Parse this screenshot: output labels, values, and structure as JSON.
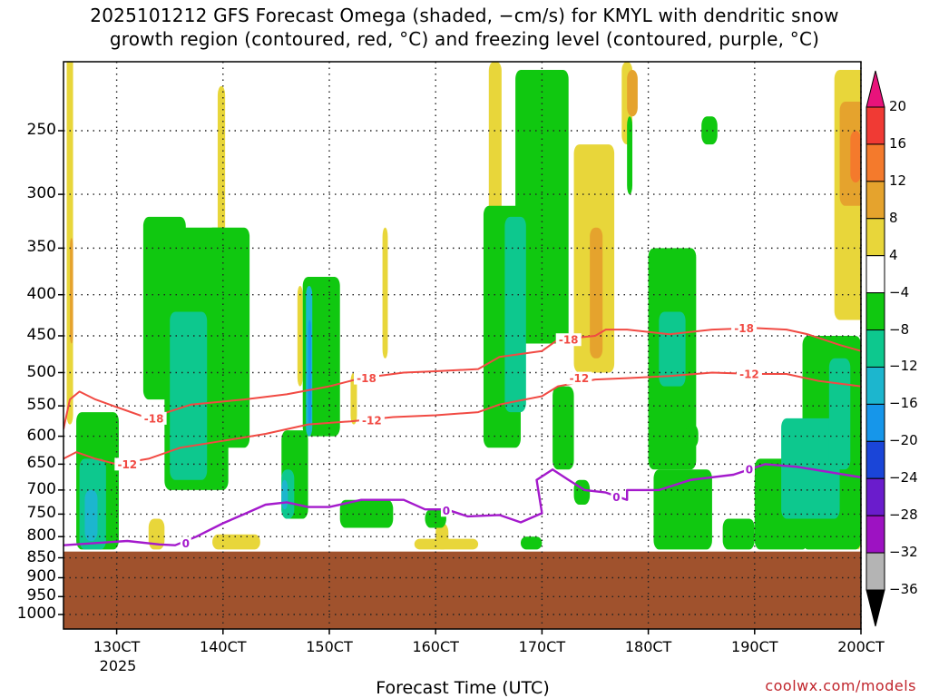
{
  "title": {
    "line1": "2025101212 GFS Forecast Omega (shaded, −cm/s) for KMYL with dendritic snow",
    "line2": "growth region (contoured, red, °C) and freezing level (contoured, purple, °C)"
  },
  "credit": "coolwx.com/models",
  "chart_data": {
    "type": "heatmap",
    "xlabel": "Forecast Time (UTC)",
    "year_label": "2025",
    "x_ticks": [
      "130CT",
      "140CT",
      "150CT",
      "160CT",
      "170CT",
      "180CT",
      "190CT",
      "200CT"
    ],
    "x_range_days": [
      12.5,
      20.0
    ],
    "y_ticks": [
      250,
      300,
      350,
      400,
      450,
      500,
      550,
      600,
      650,
      700,
      750,
      800,
      850,
      900,
      950,
      1000
    ],
    "y_range_hpa": [
      200,
      1050
    ],
    "grid": true,
    "terrain_below_hpa": 835,
    "terrain_color": "#a0522d",
    "colorbar": {
      "labels": [
        "20",
        "16",
        "12",
        "8",
        "4",
        "−4",
        "−8",
        "−12",
        "−16",
        "−20",
        "−24",
        "−28",
        "−32",
        "−36"
      ],
      "bins": [
        {
          "range": [
            20,
            999
          ],
          "color": "#e8137b"
        },
        {
          "range": [
            16,
            20
          ],
          "color": "#f03a34"
        },
        {
          "range": [
            12,
            16
          ],
          "color": "#f47a2c"
        },
        {
          "range": [
            8,
            12
          ],
          "color": "#e5a32d"
        },
        {
          "range": [
            4,
            8
          ],
          "color": "#e8d63a"
        },
        {
          "range": [
            -4,
            4
          ],
          "color": "#ffffff"
        },
        {
          "range": [
            -8,
            -4
          ],
          "color": "#10c810"
        },
        {
          "range": [
            -12,
            -8
          ],
          "color": "#0dc88e"
        },
        {
          "range": [
            -16,
            -12
          ],
          "color": "#1cb6ce"
        },
        {
          "range": [
            -20,
            -16
          ],
          "color": "#1696ea"
        },
        {
          "range": [
            -24,
            -20
          ],
          "color": "#1a45d8"
        },
        {
          "range": [
            -28,
            -24
          ],
          "color": "#6a1ccc"
        },
        {
          "range": [
            -32,
            -28
          ],
          "color": "#9d12c2"
        },
        {
          "range": [
            -36,
            -32
          ],
          "color": "#b4b4b4"
        },
        {
          "range": [
            -999,
            -36
          ],
          "color": "#000000"
        }
      ]
    },
    "omega_regions": [
      {
        "name": "yellow",
        "color": "#e8d63a",
        "value": 5,
        "x": 12.53,
        "w": 0.06,
        "p0": 200,
        "p1": 580
      },
      {
        "name": "yellow",
        "color": "#e8d63a",
        "value": 5,
        "x": 13.95,
        "w": 0.07,
        "p0": 220,
        "p1": 350
      },
      {
        "name": "yellow",
        "color": "#e8d63a",
        "value": 5,
        "x": 14.7,
        "w": 0.05,
        "p0": 390,
        "p1": 520
      },
      {
        "name": "yellow",
        "color": "#e8d63a",
        "value": 5,
        "x": 13.3,
        "w": 0.15,
        "p0": 760,
        "p1": 830
      },
      {
        "name": "yellow",
        "color": "#e8d63a",
        "value": 5,
        "x": 13.9,
        "w": 0.45,
        "p0": 795,
        "p1": 830
      },
      {
        "name": "yellow",
        "color": "#e8d63a",
        "value": 5,
        "x": 15.8,
        "w": 0.6,
        "p0": 805,
        "p1": 830
      },
      {
        "name": "yellow",
        "color": "#e8d63a",
        "value": 5,
        "x": 16.0,
        "w": 0.12,
        "p0": 770,
        "p1": 830
      },
      {
        "name": "yellow",
        "color": "#e8d63a",
        "value": 5,
        "x": 15.5,
        "w": 0.05,
        "p0": 330,
        "p1": 480
      },
      {
        "name": "yellow",
        "color": "#e8d63a",
        "value": 5,
        "x": 15.2,
        "w": 0.06,
        "p0": 500,
        "p1": 580
      },
      {
        "name": "yellow",
        "color": "#e8d63a",
        "value": 5,
        "x": 16.5,
        "w": 0.12,
        "p0": 205,
        "p1": 460
      },
      {
        "name": "yellow",
        "color": "#e8d63a",
        "value": 5,
        "x": 17.3,
        "w": 0.38,
        "p0": 260,
        "p1": 500
      },
      {
        "name": "yellow",
        "color": "#e8d63a",
        "value": 5,
        "x": 17.75,
        "w": 0.1,
        "p0": 205,
        "p1": 260
      },
      {
        "name": "yellow",
        "color": "#e8d63a",
        "value": 5,
        "x": 17.55,
        "w": 0.1,
        "p0": 435,
        "p1": 480
      },
      {
        "name": "yellow",
        "color": "#e8d63a",
        "value": 5,
        "x": 18.3,
        "w": 0.07,
        "p0": 510,
        "p1": 550
      },
      {
        "name": "yellow",
        "color": "#e8d63a",
        "value": 5,
        "x": 19.75,
        "w": 0.45,
        "p0": 210,
        "p1": 430
      },
      {
        "name": "yellow",
        "color": "#e8d63a",
        "value": 5,
        "x": 19.62,
        "w": 0.12,
        "p0": 500,
        "p1": 540
      },
      {
        "name": "yellow",
        "color": "#e8d63a",
        "value": 5,
        "x": 19.95,
        "w": 0.05,
        "p0": 760,
        "p1": 830
      },
      {
        "name": "gold",
        "color": "#e5a32d",
        "value": 10,
        "x": 17.45,
        "w": 0.12,
        "p0": 330,
        "p1": 480
      },
      {
        "name": "gold",
        "color": "#e5a32d",
        "value": 10,
        "x": 17.8,
        "w": 0.1,
        "p0": 210,
        "p1": 240
      },
      {
        "name": "gold",
        "color": "#e5a32d",
        "value": 10,
        "x": 19.8,
        "w": 0.3,
        "p0": 230,
        "p1": 310
      },
      {
        "name": "gold",
        "color": "#e5a32d",
        "value": 10,
        "x": 12.56,
        "w": 0.03,
        "p0": 340,
        "p1": 460
      },
      {
        "name": "orange",
        "color": "#f47a2c",
        "value": 14,
        "x": 19.9,
        "w": 0.1,
        "p0": 250,
        "p1": 290
      },
      {
        "name": "green",
        "color": "#10c810",
        "value": -6,
        "x": 12.62,
        "w": 0.4,
        "p0": 560,
        "p1": 830
      },
      {
        "name": "green",
        "color": "#10c810",
        "value": -6,
        "x": 13.25,
        "w": 0.4,
        "p0": 320,
        "p1": 540
      },
      {
        "name": "green",
        "color": "#10c810",
        "value": -6,
        "x": 13.45,
        "w": 0.6,
        "p0": 330,
        "p1": 700
      },
      {
        "name": "green",
        "color": "#10c810",
        "value": -6,
        "x": 13.85,
        "w": 0.4,
        "p0": 330,
        "p1": 620
      },
      {
        "name": "green",
        "color": "#10c810",
        "value": -6,
        "x": 14.55,
        "w": 0.25,
        "p0": 590,
        "p1": 760
      },
      {
        "name": "green",
        "color": "#10c810",
        "value": -6,
        "x": 14.75,
        "w": 0.35,
        "p0": 380,
        "p1": 600
      },
      {
        "name": "green",
        "color": "#10c810",
        "value": -6,
        "x": 15.1,
        "w": 0.5,
        "p0": 720,
        "p1": 780
      },
      {
        "name": "green",
        "color": "#10c810",
        "value": -6,
        "x": 15.9,
        "w": 0.2,
        "p0": 740,
        "p1": 780
      },
      {
        "name": "green",
        "color": "#10c810",
        "value": -6,
        "x": 16.45,
        "w": 0.35,
        "p0": 310,
        "p1": 620
      },
      {
        "name": "green",
        "color": "#10c810",
        "value": -6,
        "x": 16.75,
        "w": 0.5,
        "p0": 210,
        "p1": 460
      },
      {
        "name": "green",
        "color": "#10c810",
        "value": -6,
        "x": 16.8,
        "w": 0.2,
        "p0": 800,
        "p1": 830
      },
      {
        "name": "green",
        "color": "#10c810",
        "value": -6,
        "x": 17.1,
        "w": 0.2,
        "p0": 520,
        "p1": 660
      },
      {
        "name": "green",
        "color": "#10c810",
        "value": -6,
        "x": 17.3,
        "w": 0.15,
        "p0": 680,
        "p1": 730
      },
      {
        "name": "green",
        "color": "#10c810",
        "value": -6,
        "x": 17.8,
        "w": 0.05,
        "p0": 240,
        "p1": 300
      },
      {
        "name": "green",
        "color": "#10c810",
        "value": -6,
        "x": 18.0,
        "w": 0.45,
        "p0": 350,
        "p1": 660
      },
      {
        "name": "green",
        "color": "#10c810",
        "value": -6,
        "x": 18.05,
        "w": 0.55,
        "p0": 660,
        "p1": 830
      },
      {
        "name": "green",
        "color": "#10c810",
        "value": -6,
        "x": 18.5,
        "w": 0.15,
        "p0": 240,
        "p1": 260
      },
      {
        "name": "green",
        "color": "#10c810",
        "value": -6,
        "x": 18.7,
        "w": 0.3,
        "p0": 760,
        "p1": 830
      },
      {
        "name": "green",
        "color": "#10c810",
        "value": -6,
        "x": 19.0,
        "w": 0.5,
        "p0": 640,
        "p1": 830
      },
      {
        "name": "green",
        "color": "#10c810",
        "value": -6,
        "x": 19.45,
        "w": 0.55,
        "p0": 450,
        "p1": 830
      },
      {
        "name": "green",
        "color": "#10c810",
        "value": -6,
        "x": 18.35,
        "w": 0.12,
        "p0": 580,
        "p1": 620
      },
      {
        "name": "teal",
        "color": "#0dc88e",
        "value": -10,
        "x": 12.65,
        "w": 0.25,
        "p0": 640,
        "p1": 830
      },
      {
        "name": "teal",
        "color": "#0dc88e",
        "value": -10,
        "x": 13.5,
        "w": 0.35,
        "p0": 420,
        "p1": 680
      },
      {
        "name": "teal",
        "color": "#0dc88e",
        "value": -10,
        "x": 14.55,
        "w": 0.12,
        "p0": 660,
        "p1": 760
      },
      {
        "name": "teal",
        "color": "#0dc88e",
        "value": -10,
        "x": 16.65,
        "w": 0.2,
        "p0": 320,
        "p1": 560
      },
      {
        "name": "teal",
        "color": "#0dc88e",
        "value": -10,
        "x": 18.1,
        "w": 0.25,
        "p0": 420,
        "p1": 520
      },
      {
        "name": "teal",
        "color": "#0dc88e",
        "value": -10,
        "x": 19.25,
        "w": 0.55,
        "p0": 570,
        "p1": 760
      },
      {
        "name": "teal",
        "color": "#0dc88e",
        "value": -10,
        "x": 19.7,
        "w": 0.2,
        "p0": 480,
        "p1": 660
      },
      {
        "name": "cyan",
        "color": "#1cb6ce",
        "value": -14,
        "x": 12.7,
        "w": 0.12,
        "p0": 700,
        "p1": 810
      },
      {
        "name": "cyan",
        "color": "#1cb6ce",
        "value": -14,
        "x": 14.55,
        "w": 0.06,
        "p0": 680,
        "p1": 740
      },
      {
        "name": "cyan",
        "color": "#1cb6ce",
        "value": -14,
        "x": 14.78,
        "w": 0.06,
        "p0": 390,
        "p1": 600
      },
      {
        "name": "blue",
        "color": "#1696ea",
        "value": -18,
        "x": 14.8,
        "w": 0.03,
        "p0": 430,
        "p1": 580
      }
    ],
    "contours": [
      {
        "label": "-18",
        "color": "#f14a43",
        "points": [
          [
            12.5,
            588
          ],
          [
            12.56,
            540
          ],
          [
            12.65,
            528
          ],
          [
            12.8,
            540
          ],
          [
            13.0,
            552
          ],
          [
            13.3,
            570
          ],
          [
            13.7,
            548
          ],
          [
            14.2,
            540
          ],
          [
            14.6,
            532
          ],
          [
            15.0,
            520
          ],
          [
            15.3,
            508
          ],
          [
            15.7,
            500
          ],
          [
            16.0,
            498
          ],
          [
            16.4,
            495
          ],
          [
            16.6,
            478
          ],
          [
            17.0,
            470
          ],
          [
            17.15,
            455
          ],
          [
            17.5,
            450
          ],
          [
            17.6,
            442
          ],
          [
            17.8,
            442
          ],
          [
            18.2,
            448
          ],
          [
            18.6,
            442
          ],
          [
            19.0,
            440
          ],
          [
            19.3,
            442
          ],
          [
            19.5,
            448
          ],
          [
            19.8,
            462
          ],
          [
            20.0,
            470
          ]
        ],
        "labels_at": [
          [
            13.35,
            570
          ],
          [
            15.35,
            508
          ],
          [
            17.25,
            455
          ],
          [
            18.9,
            440
          ]
        ]
      },
      {
        "label": "-12",
        "color": "#f14a43",
        "points": [
          [
            12.5,
            640
          ],
          [
            12.62,
            628
          ],
          [
            12.8,
            640
          ],
          [
            13.0,
            650
          ],
          [
            13.3,
            640
          ],
          [
            13.6,
            620
          ],
          [
            14.0,
            608
          ],
          [
            14.4,
            596
          ],
          [
            14.8,
            580
          ],
          [
            15.2,
            575
          ],
          [
            15.6,
            568
          ],
          [
            16.0,
            565
          ],
          [
            16.4,
            560
          ],
          [
            16.6,
            548
          ],
          [
            17.0,
            535
          ],
          [
            17.15,
            520
          ],
          [
            17.5,
            510
          ],
          [
            17.8,
            508
          ],
          [
            18.2,
            505
          ],
          [
            18.6,
            500
          ],
          [
            19.0,
            502
          ],
          [
            19.3,
            502
          ],
          [
            19.6,
            512
          ],
          [
            20.0,
            520
          ]
        ],
        "labels_at": [
          [
            13.1,
            650
          ],
          [
            15.4,
            573
          ],
          [
            17.35,
            508
          ],
          [
            18.95,
            502
          ]
        ]
      },
      {
        "label": "0",
        "color": "#a41acc",
        "points": [
          [
            12.5,
            820
          ],
          [
            12.8,
            815
          ],
          [
            13.1,
            810
          ],
          [
            13.4,
            818
          ],
          [
            13.55,
            820
          ],
          [
            13.75,
            800
          ],
          [
            14.0,
            770
          ],
          [
            14.2,
            750
          ],
          [
            14.4,
            730
          ],
          [
            14.6,
            725
          ],
          [
            14.8,
            735
          ],
          [
            15.0,
            735
          ],
          [
            15.3,
            720
          ],
          [
            15.7,
            720
          ],
          [
            15.9,
            740
          ],
          [
            16.1,
            740
          ],
          [
            16.3,
            755
          ],
          [
            16.6,
            752
          ],
          [
            16.8,
            768
          ],
          [
            17.0,
            748
          ],
          [
            16.95,
            680
          ],
          [
            17.1,
            660
          ],
          [
            17.25,
            680
          ],
          [
            17.4,
            700
          ],
          [
            17.6,
            705
          ],
          [
            17.8,
            720
          ],
          [
            17.8,
            700
          ],
          [
            18.1,
            700
          ],
          [
            18.4,
            680
          ],
          [
            18.8,
            670
          ],
          [
            19.1,
            650
          ],
          [
            19.4,
            655
          ],
          [
            19.7,
            665
          ],
          [
            20.0,
            675
          ]
        ],
        "labels_at": [
          [
            13.65,
            815
          ],
          [
            16.1,
            742
          ],
          [
            17.7,
            714
          ],
          [
            18.95,
            660
          ]
        ]
      }
    ]
  }
}
